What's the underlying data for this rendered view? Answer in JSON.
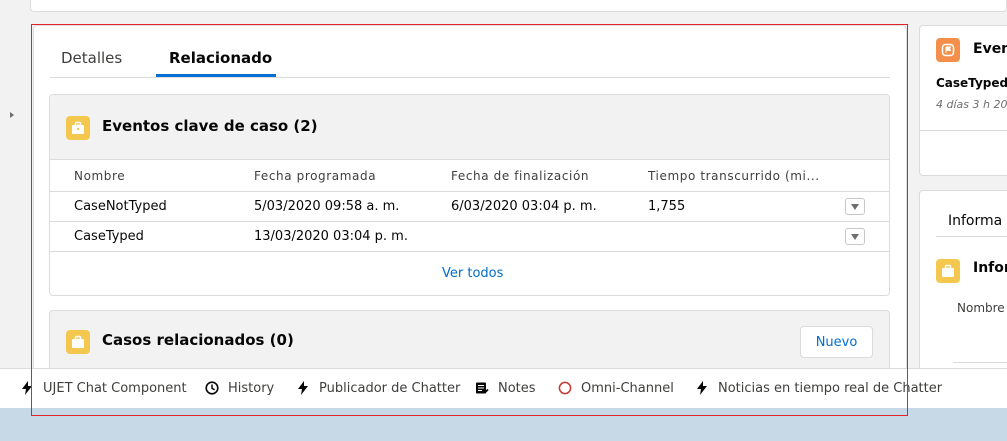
{
  "tabs": [
    {
      "label": "Detalles",
      "active": false
    },
    {
      "label": "Relacionado",
      "active": true
    }
  ],
  "key_events": {
    "title": "Eventos clave de caso (2)",
    "columns": [
      "Nombre",
      "Fecha programada",
      "Fecha de finalización",
      "Tiempo transcurrido (mi..."
    ],
    "rows": [
      {
        "name": "CaseNotTyped",
        "scheduled": "5/03/2020 09:58 a. m.",
        "completed": "6/03/2020 03:04 p. m.",
        "elapsed": "1,755"
      },
      {
        "name": "CaseTyped",
        "scheduled": "13/03/2020 03:04 p. m.",
        "completed": "",
        "elapsed": ""
      }
    ],
    "view_all": "Ver todos"
  },
  "related_cases": {
    "title": "Casos relacionados (0)",
    "new_button": "Nuevo"
  },
  "side": {
    "event_title": "Even",
    "event_name": "CaseTyped",
    "event_time": "4 días 3 h 20",
    "info_tab": "Informa",
    "info_section": "Infor",
    "info_field": "Nombre"
  },
  "utility_bar": [
    {
      "label": "UJET Chat Component",
      "icon": "bolt-icon"
    },
    {
      "label": "History",
      "icon": "clock-icon"
    },
    {
      "label": "Publicador de Chatter",
      "icon": "bolt-icon"
    },
    {
      "label": "Notes",
      "icon": "notes-icon"
    },
    {
      "label": "Omni-Channel",
      "icon": "omni-channel-status-icon"
    },
    {
      "label": "Noticias en tiempo real de Chatter",
      "icon": "bolt-icon"
    }
  ],
  "colors": {
    "brand": "#0070d2",
    "highlight_box": "#e4222c",
    "case_icon": "#f4c74f",
    "event_icon": "#f38f4a",
    "omni_status": "#c23934"
  }
}
